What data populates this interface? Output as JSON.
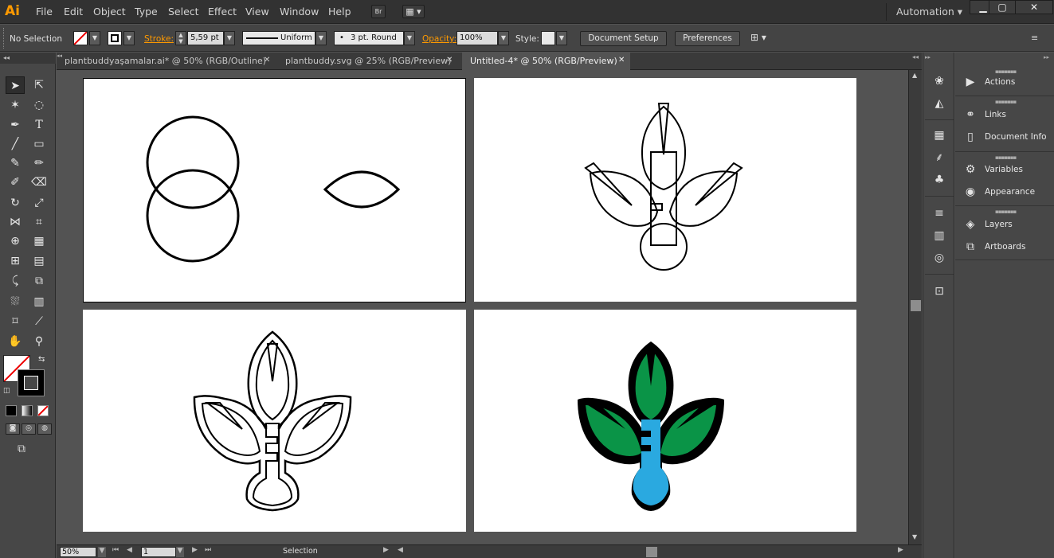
{
  "app": {
    "logo": "Ai",
    "workspace": "Automation",
    "win_min": "▁",
    "win_max": "▢",
    "win_close": "✕"
  },
  "menu": [
    "File",
    "Edit",
    "Object",
    "Type",
    "Select",
    "Effect",
    "View",
    "Window",
    "Help"
  ],
  "menubar_icons": {
    "bridge": "Br",
    "arrange": "▦ ▾"
  },
  "control": {
    "selection": "No Selection",
    "stroke_label": "Stroke:",
    "stroke_value": "5,59 pt",
    "profile": "Uniform",
    "brush": "3 pt. Round",
    "opacity_label": "Opacity:",
    "opacity_value": "100%",
    "style_label": "Style:",
    "doc_setup": "Document Setup",
    "preferences": "Preferences"
  },
  "tabs": [
    {
      "label": "plantbuddyaşamalar.ai* @ 50% (RGB/Outline)",
      "active": false
    },
    {
      "label": "plantbuddy.svg @ 25% (RGB/Preview)",
      "active": false
    },
    {
      "label": "Untitled-4* @ 50% (RGB/Preview)",
      "active": true
    }
  ],
  "status": {
    "zoom": "50%",
    "artboard": "1",
    "tool": "Selection"
  },
  "panels": [
    {
      "label": "Actions",
      "icon": "play-icon"
    },
    {
      "label": "Links",
      "icon": "links-icon"
    },
    {
      "label": "Document Info",
      "icon": "document-info-icon"
    },
    {
      "label": "Variables",
      "icon": "variables-icon"
    },
    {
      "label": "Appearance",
      "icon": "appearance-icon"
    },
    {
      "label": "Layers",
      "icon": "layers-icon"
    },
    {
      "label": "Artboards",
      "icon": "artboards-icon"
    }
  ],
  "colors": {
    "accent": "#ff9a00",
    "leaf_green": "#0a9447",
    "bulb_blue": "#2aa9e0",
    "stroke": "#000000"
  }
}
